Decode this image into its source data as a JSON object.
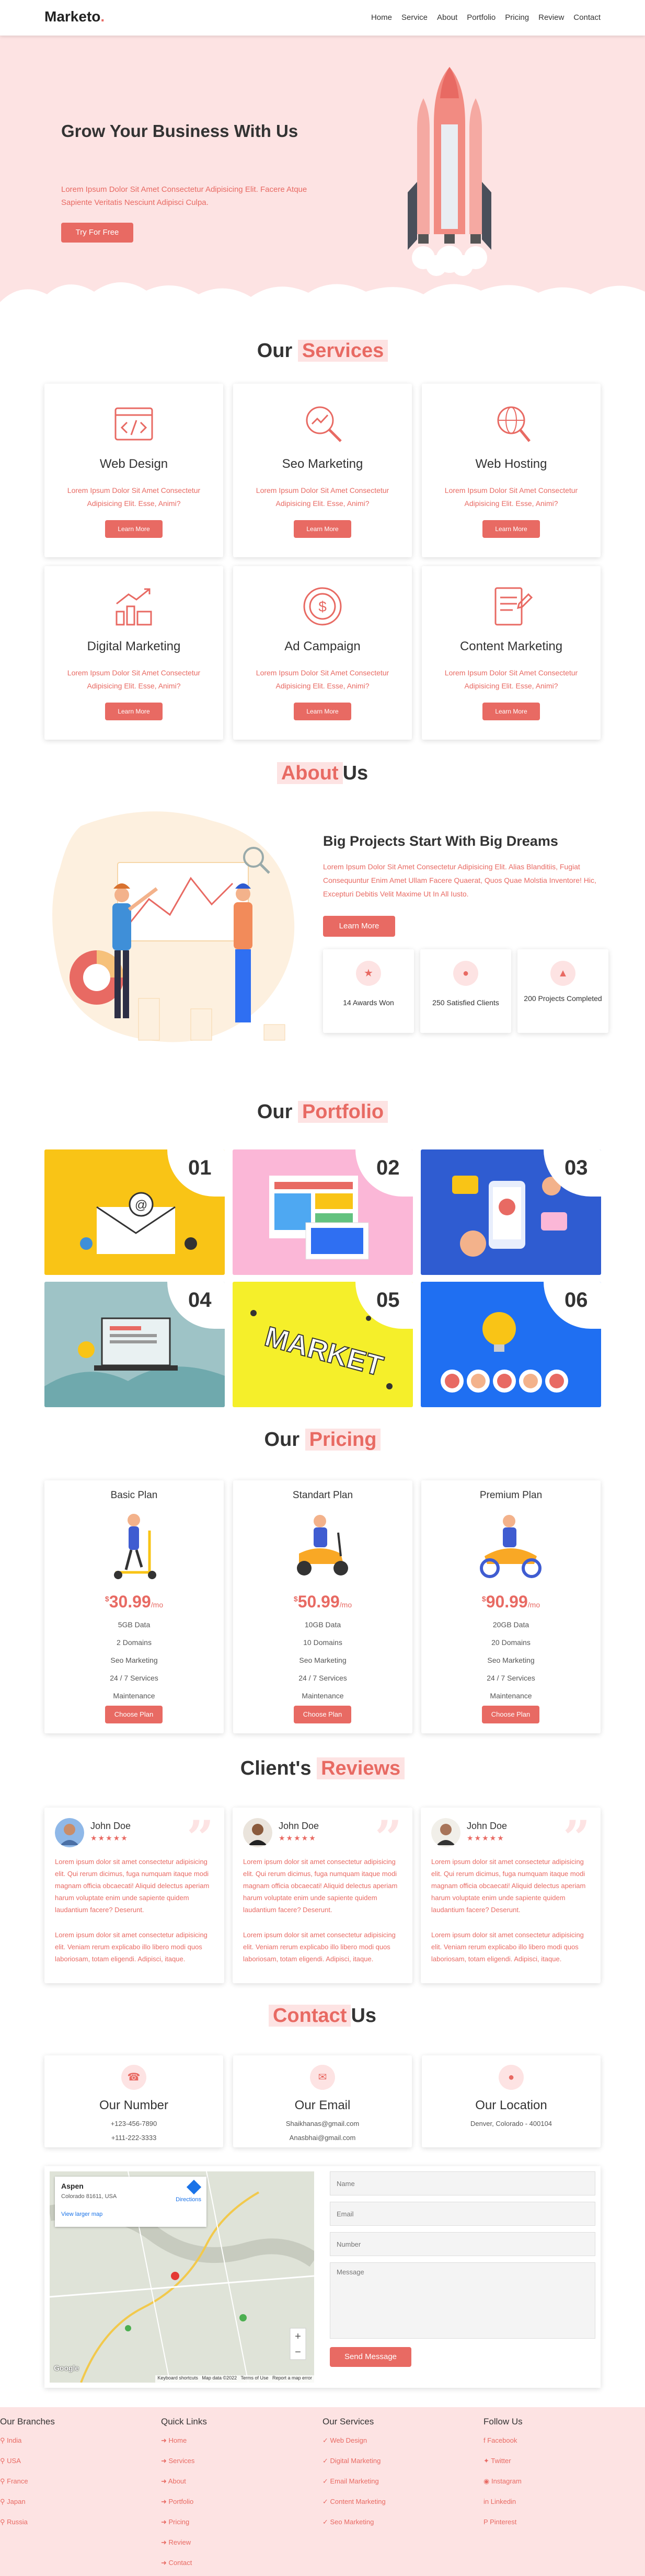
{
  "header": {
    "logo": "Marketo",
    "logo_dot": ".",
    "nav": [
      "Home",
      "Service",
      "About",
      "Portfolio",
      "Pricing",
      "Review",
      "Contact"
    ]
  },
  "hero": {
    "title": "Grow Your Business With Us",
    "text": "Lorem Ipsum Dolor Sit Amet Consectetur Adipisicing Elit. Facere Atque Sapiente Veritatis Nesciunt Adipisci Culpa.",
    "button": "Try For Free"
  },
  "services": {
    "title_a": "Our",
    "title_b": "Services",
    "items": [
      {
        "icon": "web-design-icon",
        "title": "Web Design",
        "desc": "Lorem Ipsum Dolor Sit Amet Consectetur Adipisicing Elit. Esse, Animi?",
        "button": "Learn More"
      },
      {
        "icon": "seo-icon",
        "title": "Seo Marketing",
        "desc": "Lorem Ipsum Dolor Sit Amet Consectetur Adipisicing Elit. Esse, Animi?",
        "button": "Learn More"
      },
      {
        "icon": "web-hosting-icon",
        "title": "Web Hosting",
        "desc": "Lorem Ipsum Dolor Sit Amet Consectetur Adipisicing Elit. Esse, Animi?",
        "button": "Learn More"
      },
      {
        "icon": "digital-marketing-icon",
        "title": "Digital Marketing",
        "desc": "Lorem Ipsum Dolor Sit Amet Consectetur Adipisicing Elit. Esse, Animi?",
        "button": "Learn More"
      },
      {
        "icon": "ad-campaign-icon",
        "title": "Ad Campaign",
        "desc": "Lorem Ipsum Dolor Sit Amet Consectetur Adipisicing Elit. Esse, Animi?",
        "button": "Learn More"
      },
      {
        "icon": "content-marketing-icon",
        "title": "Content Marketing",
        "desc": "Lorem Ipsum Dolor Sit Amet Consectetur Adipisicing Elit. Esse, Animi?",
        "button": "Learn More"
      }
    ]
  },
  "about": {
    "title_a": "About",
    "title_b": "Us",
    "heading": "Big Projects Start With Big Dreams",
    "text": "Lorem Ipsum Dolor Sit Amet Consectetur Adipisicing Elit. Alias Blanditiis, Fugiat Consequuntur Enim Amet Ullam Facere Quaerat, Quos Quae Molstia Inventore! Hic, Excepturi Debitis Velit Maxime Ut In All Iusto.",
    "button": "Learn More",
    "stats": [
      {
        "icon": "award-icon",
        "label": "14 Awards Won"
      },
      {
        "icon": "user-icon",
        "label": "250 Satisfied Clients"
      },
      {
        "icon": "project-icon",
        "label": "200 Projects Completed"
      }
    ]
  },
  "portfolio": {
    "title_a": "Our",
    "title_b": "Portfolio",
    "items": [
      {
        "num": "01",
        "color": "#f9c416"
      },
      {
        "num": "02",
        "color": "#fbb7d7"
      },
      {
        "num": "03",
        "color": "#2f5cd1"
      },
      {
        "num": "04",
        "color": "#9ec3c6"
      },
      {
        "num": "05",
        "color": "#f5ef2a"
      },
      {
        "num": "06",
        "color": "#1f6ff2"
      }
    ]
  },
  "pricing": {
    "title_a": "Our",
    "title_b": "Pricing",
    "plans": [
      {
        "name": "Basic Plan",
        "currency": "$",
        "price": "30.99",
        "per": "/mo",
        "features": [
          "5GB Data",
          "2 Domains",
          "Seo Marketing",
          "24 / 7 Services",
          "Maintenance"
        ],
        "button": "Choose Plan"
      },
      {
        "name": "Standart Plan",
        "currency": "$",
        "price": "50.99",
        "per": "/mo",
        "features": [
          "10GB Data",
          "10 Domains",
          "Seo Marketing",
          "24 / 7 Services",
          "Maintenance"
        ],
        "button": "Choose Plan"
      },
      {
        "name": "Premium Plan",
        "currency": "$",
        "price": "90.99",
        "per": "/mo",
        "features": [
          "20GB Data",
          "20 Domains",
          "Seo Marketing",
          "24 / 7 Services",
          "Maintenance"
        ],
        "button": "Choose Plan"
      }
    ]
  },
  "reviews": {
    "title_a": "Client's",
    "title_b": "Reviews",
    "items": [
      {
        "name": "John Doe",
        "stars": "★★★★★",
        "p1": "Lorem ipsum dolor sit amet consectetur adipisicing elit. Qui rerum dicimus, fuga numquam itaque modi magnam officia obcaecati! Aliquid delectus aperiam harum voluptate enim unde sapiente quidem laudantium facere? Deserunt.",
        "p2": "Lorem ipsum dolor sit amet consectetur adipisicing elit. Veniam rerum explicabo illo libero modi quos laboriosam, totam eligendi. Adipisci, itaque."
      },
      {
        "name": "John Doe",
        "stars": "★★★★★",
        "p1": "Lorem ipsum dolor sit amet consectetur adipisicing elit. Qui rerum dicimus, fuga numquam itaque modi magnam officia obcaecati! Aliquid delectus aperiam harum voluptate enim unde sapiente quidem laudantium facere? Deserunt.",
        "p2": "Lorem ipsum dolor sit amet consectetur adipisicing elit. Veniam rerum explicabo illo libero modi quos laboriosam, totam eligendi. Adipisci, itaque."
      },
      {
        "name": "John Doe",
        "stars": "★★★★★",
        "p1": "Lorem ipsum dolor sit amet consectetur adipisicing elit. Qui rerum dicimus, fuga numquam itaque modi magnam officia obcaecati! Aliquid delectus aperiam harum voluptate enim unde sapiente quidem laudantium facere? Deserunt.",
        "p2": "Lorem ipsum dolor sit amet consectetur adipisicing elit. Veniam rerum explicabo illo libero modi quos laboriosam, totam eligendi. Adipisci, itaque."
      }
    ]
  },
  "contact": {
    "title_a": "Contact",
    "title_b": "Us",
    "cards": [
      {
        "icon": "phone-icon",
        "title": "Our Number",
        "lines": [
          "+123-456-7890",
          "+111-222-3333"
        ]
      },
      {
        "icon": "email-icon",
        "title": "Our Email",
        "lines": [
          "Shaikhanas@gmail.com",
          "Anasbhai@gmail.com"
        ]
      },
      {
        "icon": "location-icon",
        "title": "Our Location",
        "lines": [
          "Denver, Colorado - 400104"
        ]
      }
    ],
    "map": {
      "place": "Aspen",
      "address": "Colorado 81611, USA",
      "directions": "Directions",
      "larger": "View larger map",
      "google": "Google",
      "attribution": "Keyboard shortcuts   Map data ©2022   Terms of Use   Report a map error"
    },
    "form": {
      "name": "Name",
      "email": "Email",
      "number": "Number",
      "message": "Message",
      "button": "Send Message"
    }
  },
  "footer": {
    "branches": {
      "title": "Our Branches",
      "items": [
        "India",
        "USA",
        "France",
        "Japan",
        "Russia"
      ]
    },
    "links": {
      "title": "Quick Links",
      "items": [
        "Home",
        "Services",
        "About",
        "Portfolio",
        "Pricing",
        "Review",
        "Contact"
      ]
    },
    "services": {
      "title": "Our Services",
      "items": [
        "Web Design",
        "Digital Marketing",
        "Email Marketing",
        "Content Marketing",
        "Seo Marketing"
      ]
    },
    "follow": {
      "title": "Follow Us",
      "items": [
        "Facebook",
        "Twitter",
        "Instagram",
        "Linkedin",
        "Pinterest"
      ]
    }
  },
  "colors": {
    "accent": "#e86a63",
    "accent_light": "#fde3e3"
  }
}
